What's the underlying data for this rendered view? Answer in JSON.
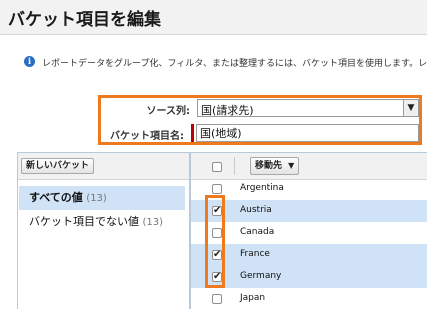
{
  "page": {
    "title": "バケット項目を編集"
  },
  "info": {
    "text": "レポートデータをグループ化、フィルタ、または整理するには、バケット項目を使用します。レポ"
  },
  "form": {
    "source_column_label": "ソース列:",
    "source_column_value": "国(請求先)",
    "bucket_field_name_label": "バケット項目名:",
    "bucket_field_name_value": "国(地域)"
  },
  "buckets": {
    "new_bucket_button": "新しいバケット",
    "items": [
      {
        "name": "すべての値",
        "count": "(13)",
        "selected": true
      },
      {
        "name": "バケット項目でない値",
        "count": "(13)",
        "selected": false
      }
    ]
  },
  "values": {
    "move_to_button": "移動先",
    "rows": [
      {
        "label": "Argentina",
        "checked": false
      },
      {
        "label": "Austria",
        "checked": true
      },
      {
        "label": "Canada",
        "checked": false
      },
      {
        "label": "France",
        "checked": true
      },
      {
        "label": "Germany",
        "checked": true
      },
      {
        "label": "Japan",
        "checked": false
      }
    ]
  },
  "colors": {
    "highlight": "#ee7a1f",
    "selected_row": "#cfe2f6",
    "required": "#c00000"
  }
}
